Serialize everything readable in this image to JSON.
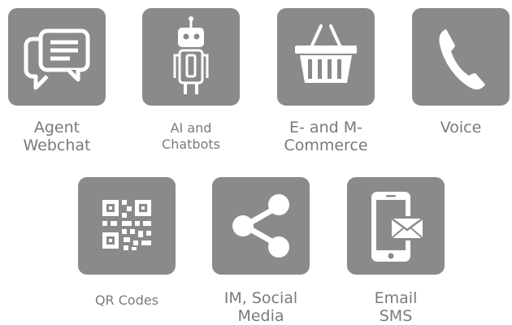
{
  "tiles": [
    {
      "icon": "chat-bubbles-icon",
      "label": "Agent\nWebchat"
    },
    {
      "icon": "robot-icon",
      "label": "AI and\nChatbots"
    },
    {
      "icon": "shopping-basket-icon",
      "label": "E- and M-\nCommerce"
    },
    {
      "icon": "phone-icon",
      "label": "Voice"
    },
    {
      "icon": "qr-code-icon",
      "label": "QR Codes"
    },
    {
      "icon": "share-icon",
      "label": "IM, Social\nMedia"
    },
    {
      "icon": "mobile-email-icon",
      "label": "Email\nSMS"
    }
  ],
  "colors": {
    "tile": "#8a8a8a",
    "icon": "#ffffff",
    "text": "#7a7a7a"
  }
}
